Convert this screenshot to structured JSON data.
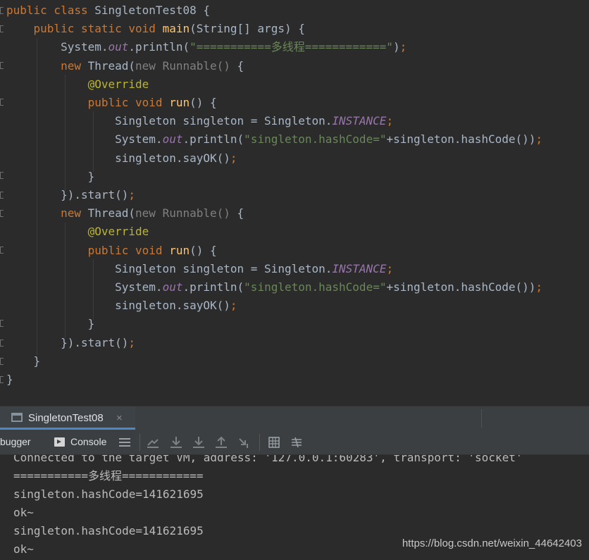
{
  "editor": {
    "lines": [
      [
        {
          "t": "public class ",
          "c": "kw"
        },
        {
          "t": "SingletonTest08 {",
          "c": "plain"
        }
      ],
      [
        {
          "t": "    public static void ",
          "c": "kw"
        },
        {
          "t": "main",
          "c": "fn"
        },
        {
          "t": "(String[] args) {",
          "c": "plain"
        }
      ],
      [
        {
          "t": "        System.",
          "c": "plain"
        },
        {
          "t": "out",
          "c": "field"
        },
        {
          "t": ".println(",
          "c": "plain"
        },
        {
          "t": "\"===========多线程============\"",
          "c": "str"
        },
        {
          "t": ")",
          "c": "plain"
        },
        {
          "t": ";",
          "c": "kw"
        }
      ],
      [
        {
          "t": "        new ",
          "c": "kw"
        },
        {
          "t": "Thread(",
          "c": "plain"
        },
        {
          "t": "new Runnable()",
          "c": "muted"
        },
        {
          "t": " {",
          "c": "plain"
        }
      ],
      [
        {
          "t": "            @Override",
          "c": "ann"
        }
      ],
      [
        {
          "t": "            public void ",
          "c": "kw"
        },
        {
          "t": "run",
          "c": "fn"
        },
        {
          "t": "() {",
          "c": "plain"
        }
      ],
      [
        {
          "t": "                Singleton singleton = Singleton.",
          "c": "plain"
        },
        {
          "t": "INSTANCE",
          "c": "field"
        },
        {
          "t": ";",
          "c": "kw"
        }
      ],
      [
        {
          "t": "                System.",
          "c": "plain"
        },
        {
          "t": "out",
          "c": "field"
        },
        {
          "t": ".println(",
          "c": "plain"
        },
        {
          "t": "\"singleton.hashCode=\"",
          "c": "str"
        },
        {
          "t": "+singleton.hashCode())",
          "c": "plain"
        },
        {
          "t": ";",
          "c": "kw"
        }
      ],
      [
        {
          "t": "                singleton.sayOK()",
          "c": "plain"
        },
        {
          "t": ";",
          "c": "kw"
        }
      ],
      [
        {
          "t": "            }",
          "c": "plain"
        }
      ],
      [
        {
          "t": "        }).start()",
          "c": "plain"
        },
        {
          "t": ";",
          "c": "kw"
        }
      ],
      [
        {
          "t": "        new ",
          "c": "kw"
        },
        {
          "t": "Thread(",
          "c": "plain"
        },
        {
          "t": "new Runnable()",
          "c": "muted"
        },
        {
          "t": " {",
          "c": "plain"
        }
      ],
      [
        {
          "t": "            @Override",
          "c": "ann"
        }
      ],
      [
        {
          "t": "            public void ",
          "c": "kw"
        },
        {
          "t": "run",
          "c": "fn"
        },
        {
          "t": "() {",
          "c": "plain"
        }
      ],
      [
        {
          "t": "                Singleton singleton = Singleton.",
          "c": "plain"
        },
        {
          "t": "INSTANCE",
          "c": "field"
        },
        {
          "t": ";",
          "c": "kw"
        }
      ],
      [
        {
          "t": "                System.",
          "c": "plain"
        },
        {
          "t": "out",
          "c": "field"
        },
        {
          "t": ".println(",
          "c": "plain"
        },
        {
          "t": "\"singleton.hashCode=\"",
          "c": "str"
        },
        {
          "t": "+singleton.hashCode())",
          "c": "plain"
        },
        {
          "t": ";",
          "c": "kw"
        }
      ],
      [
        {
          "t": "                singleton.sayOK()",
          "c": "plain"
        },
        {
          "t": ";",
          "c": "kw"
        }
      ],
      [
        {
          "t": "            }",
          "c": "plain"
        }
      ],
      [
        {
          "t": "        }).start()",
          "c": "plain"
        },
        {
          "t": ";",
          "c": "kw"
        }
      ],
      [
        {
          "t": "    }",
          "c": "plain"
        }
      ],
      [
        {
          "t": "}",
          "c": "plain"
        }
      ]
    ]
  },
  "run_tab": {
    "label": "SingletonTest08",
    "close_glyph": "×",
    "icon": "console-window-icon"
  },
  "toolbar": {
    "debugger_label": "bugger",
    "console_label": "Console",
    "icons": [
      "menu-icon",
      "show-execution-point-icon",
      "step-over-icon",
      "step-into-icon",
      "step-out-icon",
      "run-to-cursor-icon",
      "evaluate-expression-icon",
      "trace-icon"
    ]
  },
  "console": {
    "lines": [
      "Connected to the target VM, address: '127.0.0.1:60283', transport: 'socket'",
      "===========多线程============",
      "singleton.hashCode=141621695",
      "ok~",
      "singleton.hashCode=141621695",
      "ok~"
    ]
  },
  "watermark": "https://blog.csdn.net/weixin_44642403",
  "colors": {
    "editor_bg": "#2b2b2b",
    "keyword": "#cc7832",
    "function": "#ffc66d",
    "string": "#6a8759",
    "field": "#9876aa",
    "annotation": "#bbb529",
    "accent": "#4a88c7"
  }
}
